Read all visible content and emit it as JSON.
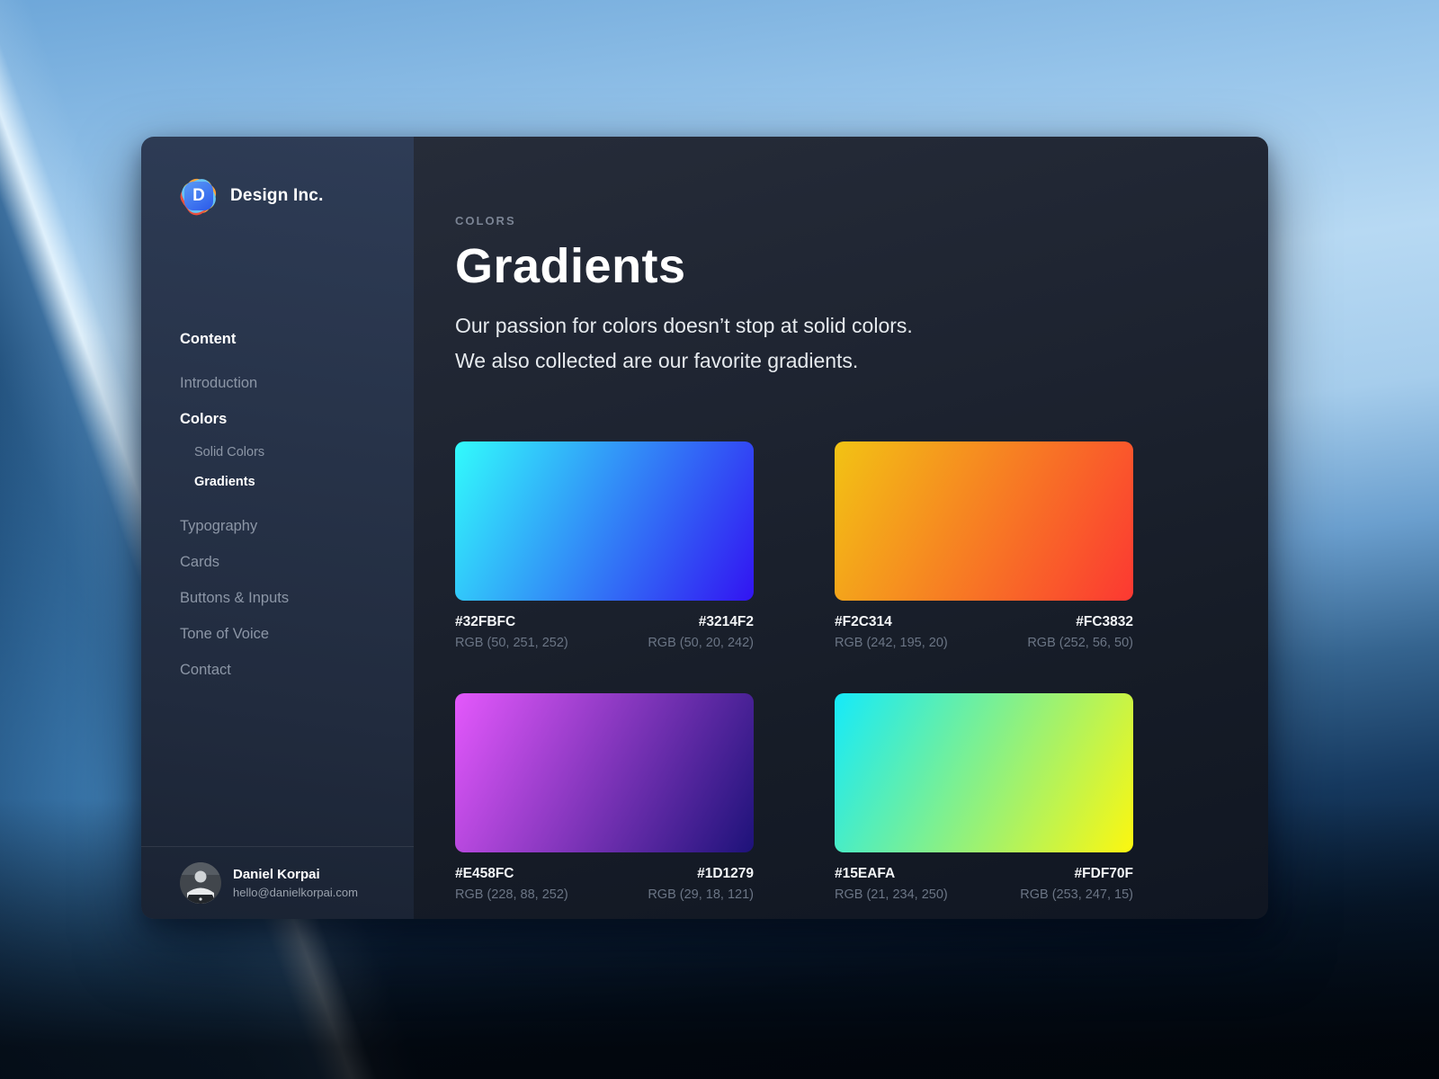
{
  "brand": {
    "name": "Design Inc.",
    "logo_letter": "D"
  },
  "sidebar": {
    "nav": [
      {
        "label": "Content"
      },
      {
        "label": "Introduction"
      },
      {
        "label": "Colors"
      },
      {
        "label": "Solid Colors"
      },
      {
        "label": "Gradients"
      },
      {
        "label": "Typography"
      },
      {
        "label": "Cards"
      },
      {
        "label": "Buttons & Inputs"
      },
      {
        "label": "Tone of Voice"
      },
      {
        "label": "Contact"
      }
    ],
    "user": {
      "name": "Daniel Korpai",
      "email": "hello@danielkorpai.com"
    }
  },
  "main": {
    "eyebrow": "COLORS",
    "title": "Gradients",
    "description_line1": "Our passion for colors doesn’t stop at solid colors.",
    "description_line2": "We also collected are our favorite gradients.",
    "gradient_angle_deg": 118,
    "gradients": [
      {
        "from_hex": "#32FBFC",
        "from_rgb": "RGB (50, 251, 252)",
        "to_hex": "#3214F2",
        "to_rgb": "RGB (50, 20, 242)"
      },
      {
        "from_hex": "#F2C314",
        "from_rgb": "RGB (242, 195, 20)",
        "to_hex": "#FC3832",
        "to_rgb": "RGB (252, 56, 50)"
      },
      {
        "from_hex": "#E458FC",
        "from_rgb": "RGB (228, 88, 252)",
        "to_hex": "#1D1279",
        "to_rgb": "RGB (29, 18, 121)"
      },
      {
        "from_hex": "#15EAFA",
        "from_rgb": "RGB (21, 234, 250)",
        "to_hex": "#FDF70F",
        "to_rgb": "RGB (253, 247, 15)"
      }
    ]
  }
}
